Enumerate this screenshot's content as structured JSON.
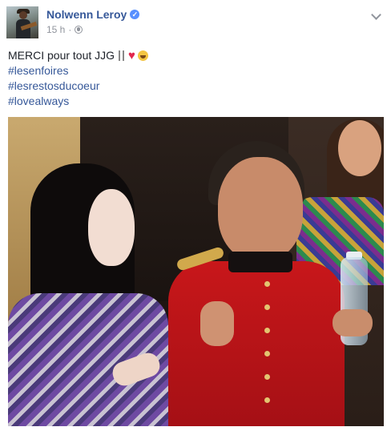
{
  "post": {
    "author": "Nolwenn Leroy",
    "verified_icon": "verified-badge-icon",
    "time": "15 h",
    "separator": "·",
    "privacy_icon": "globe-icon",
    "menu_icon": "chevron-down-icon"
  },
  "content": {
    "message": "MERCI pour tout JJG",
    "emojis": [
      "cutlery-icon",
      "heart-icon",
      "face-icon"
    ],
    "hashtags": [
      "#lesenfoires",
      "#lesrestosducoeur",
      "#lovealways"
    ]
  },
  "colors": {
    "link": "#365899",
    "meta": "#90949c",
    "text": "#1d2129",
    "verified": "#5890ff"
  }
}
